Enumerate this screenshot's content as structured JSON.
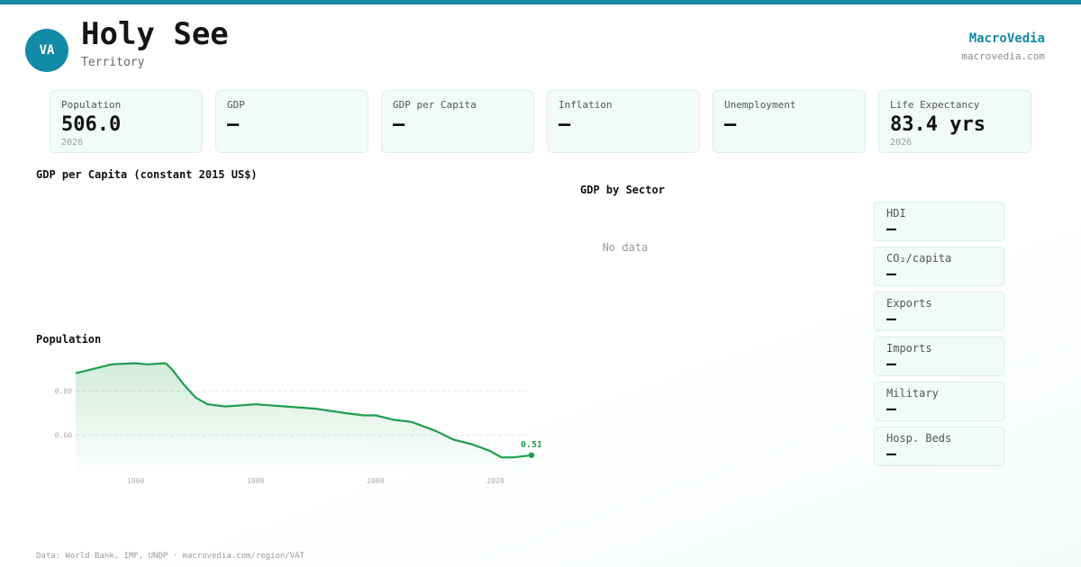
{
  "header": {
    "avatar": "VA",
    "title": "Holy See",
    "subtitle": "Territory",
    "brand": "MacroVedia",
    "brand_url": "macrovedia.com"
  },
  "stats": [
    {
      "label": "Population",
      "value": "506.0",
      "year": "2026"
    },
    {
      "label": "GDP",
      "value": "—",
      "year": ""
    },
    {
      "label": "GDP per Capita",
      "value": "—",
      "year": ""
    },
    {
      "label": "Inflation",
      "value": "—",
      "year": ""
    },
    {
      "label": "Unemployment",
      "value": "—",
      "year": ""
    },
    {
      "label": "Life Expectancy",
      "value": "83.4 yrs",
      "year": "2026"
    }
  ],
  "sections": {
    "gdp_per_capita": "GDP per Capita (constant 2015 US$)",
    "population": "Population",
    "gdp_by_sector": "GDP by Sector",
    "no_data": "No data"
  },
  "side_metrics": [
    {
      "label": "HDI",
      "value": "—"
    },
    {
      "label": "CO₂/capita",
      "value": "—"
    },
    {
      "label": "Exports",
      "value": "—"
    },
    {
      "label": "Imports",
      "value": "—"
    },
    {
      "label": "Military",
      "value": "—"
    },
    {
      "label": "Hosp. Beds",
      "value": "—"
    }
  ],
  "chart_data": {
    "type": "area",
    "title": "Population",
    "xlabel": "",
    "ylabel": "",
    "x_ticks": [
      "1960",
      "1980",
      "2000",
      "2020"
    ],
    "y_ticks": [
      "0.60",
      "0.80"
    ],
    "xlim": [
      1950,
      2026
    ],
    "ylim": [
      0.44,
      0.96
    ],
    "grid": true,
    "color": "#1e9e4e",
    "end_label": "0.51",
    "series": [
      {
        "x": [
          1950,
          1953,
          1956,
          1960,
          1962,
          1965,
          1966,
          1968,
          1970,
          1972,
          1975,
          1980,
          1985,
          1990,
          1995,
          1998,
          2000,
          2003,
          2006,
          2010,
          2013,
          2016,
          2019,
          2021,
          2023,
          2026
        ],
        "values": [
          0.88,
          0.9,
          0.92,
          0.925,
          0.92,
          0.925,
          0.9,
          0.83,
          0.77,
          0.74,
          0.73,
          0.74,
          0.73,
          0.72,
          0.7,
          0.69,
          0.69,
          0.67,
          0.66,
          0.62,
          0.58,
          0.56,
          0.53,
          0.5,
          0.5,
          0.51
        ]
      }
    ]
  },
  "footer": "Data: World Bank, IMF, UNDP · macrovedia.com/region/VAT"
}
